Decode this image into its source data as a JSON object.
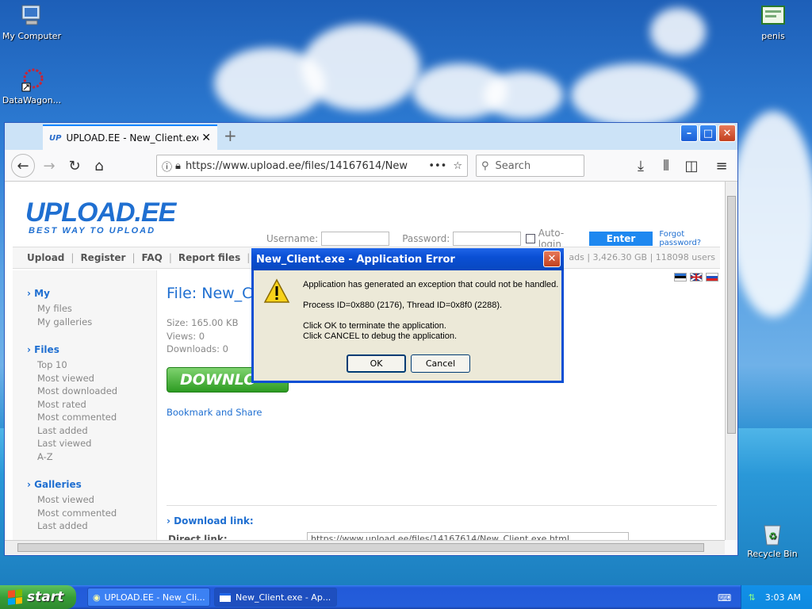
{
  "desktop": {
    "icons": [
      {
        "label": "My Computer"
      },
      {
        "label": "DataWagon..."
      },
      {
        "label": "penis"
      },
      {
        "label": "Recycle Bin"
      }
    ]
  },
  "browser": {
    "tab_title": "UPLOAD.EE - New_Client.exe - Do",
    "tab_favicon": "UP",
    "url": "https://www.upload.ee/files/14167614/New",
    "search_placeholder": "Search",
    "new_tab": "+"
  },
  "page": {
    "logo": "UPLOAD.EE",
    "slogan": "BEST WAY TO UPLOAD",
    "login": {
      "username_label": "Username:",
      "password_label": "Password:",
      "autologin_label": "Auto-login",
      "enter_label": "Enter",
      "forgot_label": "Forgot password?"
    },
    "menu": [
      "Upload",
      "Register",
      "FAQ",
      "Report files"
    ],
    "stats": "ads  |  3,426.30 GB  |  118098 users",
    "sidebar": {
      "my": {
        "title": "My",
        "items": [
          "My files",
          "My galleries"
        ]
      },
      "files": {
        "title": "Files",
        "items": [
          "Top 10",
          "Most viewed",
          "Most downloaded",
          "Most rated",
          "Most commented",
          "Last added",
          "Last viewed",
          "A-Z"
        ]
      },
      "galleries": {
        "title": "Galleries",
        "items": [
          "Most viewed",
          "Most commented",
          "Last added"
        ]
      }
    },
    "file": {
      "title": "File: New_C",
      "size": "Size: 165.00 KB",
      "views": "Views: 0",
      "downloads": "Downloads: 0",
      "download_button": "DOWNLO",
      "bookmark": "Bookmark and Share",
      "download_link_label": "Download link:",
      "direct_link_label": "Direct link:",
      "direct_link_value": "https://www.upload.ee/files/14167614/New_Client.exe.html"
    }
  },
  "dialog": {
    "title": "New_Client.exe - Application Error",
    "line1": "Application has generated an exception that could not be handled.",
    "line2": "Process ID=0x880 (2176), Thread ID=0x8f0 (2288).",
    "line3": "Click OK to terminate the application.",
    "line4": "Click CANCEL to debug the application.",
    "ok_label": "OK",
    "cancel_label": "Cancel"
  },
  "taskbar": {
    "start_label": "start",
    "tasks": [
      {
        "label": "UPLOAD.EE - New_Cli..."
      },
      {
        "label": "New_Client.exe - Ap..."
      }
    ],
    "clock": "3:03 AM"
  }
}
